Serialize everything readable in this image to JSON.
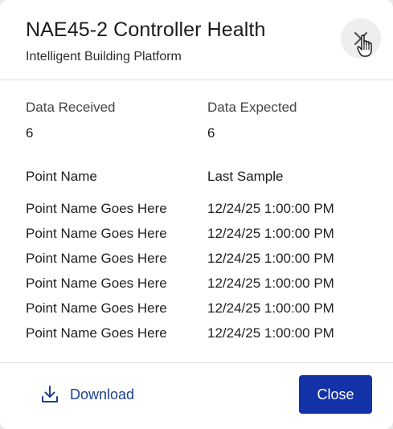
{
  "dialog": {
    "title": "NAE45-2 Controller Health",
    "subtitle": "Intelligent Building Platform",
    "close_icon": "close-icon"
  },
  "stats": {
    "received_label": "Data Received",
    "received_value": "6",
    "expected_label": "Data Expected",
    "expected_value": "6"
  },
  "table": {
    "columns": [
      "Point Name",
      "Last Sample"
    ],
    "rows": [
      {
        "name": "Point Name Goes Here",
        "sample": "12/24/25 1:00:00 PM"
      },
      {
        "name": "Point Name Goes Here",
        "sample": "12/24/25 1:00:00 PM"
      },
      {
        "name": "Point Name Goes Here",
        "sample": "12/24/25 1:00:00 PM"
      },
      {
        "name": "Point Name Goes Here",
        "sample": "12/24/25 1:00:00 PM"
      },
      {
        "name": "Point Name Goes Here",
        "sample": "12/24/25 1:00:00 PM"
      },
      {
        "name": "Point Name Goes Here",
        "sample": "12/24/25 1:00:00 PM"
      }
    ]
  },
  "footer": {
    "download_label": "Download",
    "download_icon": "download-icon",
    "close_label": "Close"
  },
  "colors": {
    "primary": "#1432a8",
    "link": "#1c3f8f"
  }
}
